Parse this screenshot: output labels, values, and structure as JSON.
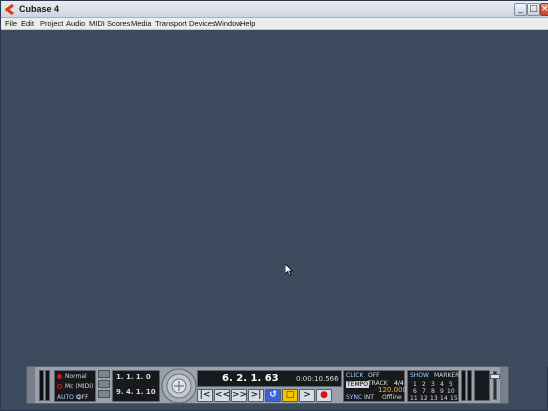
{
  "window": {
    "title": "Cubase 4",
    "buttons": {
      "minimize": "_",
      "maximize": "□",
      "close": "×"
    }
  },
  "menu": {
    "items": [
      "File",
      "Edit",
      "Project",
      "Audio",
      "MIDI",
      "Scores",
      "Media",
      "Transport",
      "Devices",
      "Window",
      "Help"
    ]
  },
  "transport": {
    "left_section": {
      "mode": "Normal",
      "input": "Mc (MIDI)",
      "auto_label": "AUTO Q",
      "auto_value": "OFF"
    },
    "locators": {
      "left": "1. 1. 1.   0",
      "right": "9. 4. 1. 10"
    },
    "position": {
      "bars": "6. 2. 1. 63",
      "time": "0:00:10.566"
    },
    "buttons": {
      "rewind_start": "|<",
      "rewind": "<<",
      "forward": ">>",
      "forward_end": ">|",
      "cycle": "↺",
      "stop": "□",
      "play": ">",
      "record": "●"
    },
    "click": {
      "label": "CLICK",
      "value": "OFF"
    },
    "tempo": {
      "label": "TEMPO",
      "sub": "TRACK",
      "signature": "4/4",
      "bpm": "120.000"
    },
    "sync": {
      "label": "SYNC",
      "source": "INT",
      "status": "Offline"
    },
    "marker": {
      "show_label": "SHOW",
      "marker_label": "MARKER",
      "numbers": [
        "1",
        "2",
        "3",
        "4",
        "5",
        "6",
        "7",
        "8",
        "9",
        "10",
        "11",
        "12",
        "13",
        "14",
        "15"
      ]
    },
    "colors": {
      "background": "#9aa1aa",
      "record": "#e01010",
      "cycle": "#3b63d6",
      "stop": "#f4c400",
      "workspace": "#3b4a5c"
    }
  }
}
